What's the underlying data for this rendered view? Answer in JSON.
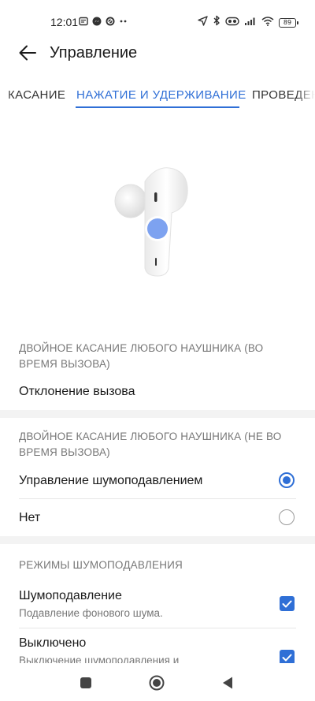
{
  "status_bar": {
    "time": "12:01",
    "battery": "89",
    "left_icons": [
      "message-icon",
      "messenger-icon",
      "blocked-icon",
      "more-dots-icon"
    ],
    "right_icons": [
      "location-arrow-icon",
      "bluetooth-icon",
      "earbuds-icon",
      "signal-icon",
      "wifi-icon",
      "battery-icon"
    ]
  },
  "app_bar": {
    "title": "Управление"
  },
  "tabs": [
    {
      "label": "КАСАНИЕ"
    },
    {
      "label": "НАЖАТИЕ И УДЕРЖИВАНИЕ",
      "active": true
    },
    {
      "label": "ПРОВЕДЕНИЕ"
    }
  ],
  "sections": {
    "call": {
      "header": "ДВОЙНОЕ КАСАНИЕ ЛЮБОГО НАУШНИКА (ВО ВРЕМЯ ВЫЗОВА)",
      "item": "Отклонение вызова"
    },
    "no_call": {
      "header": "ДВОЙНОЕ КАСАНИЕ ЛЮБОГО НАУШНИКА (НЕ ВО ВРЕМЯ ВЫЗОВА)",
      "options": [
        {
          "label": "Управление шумоподавлением",
          "selected": true
        },
        {
          "label": "Нет",
          "selected": false
        }
      ]
    },
    "nc_modes": {
      "header": "РЕЖИМЫ ШУМОПОДАВЛЕНИЯ",
      "items": [
        {
          "label": "Шумоподавление",
          "sub": "Подавление фонового шума.",
          "checked": true
        },
        {
          "label": "Выключено",
          "sub": "Выключение шумоподавления и",
          "checked": true
        }
      ]
    }
  },
  "colors": {
    "accent": "#2f6fd6",
    "touch_indicator": "#7da2f0"
  },
  "nav_bar": {
    "buttons": [
      "recents-square-icon",
      "home-circle-icon",
      "back-triangle-icon"
    ]
  }
}
